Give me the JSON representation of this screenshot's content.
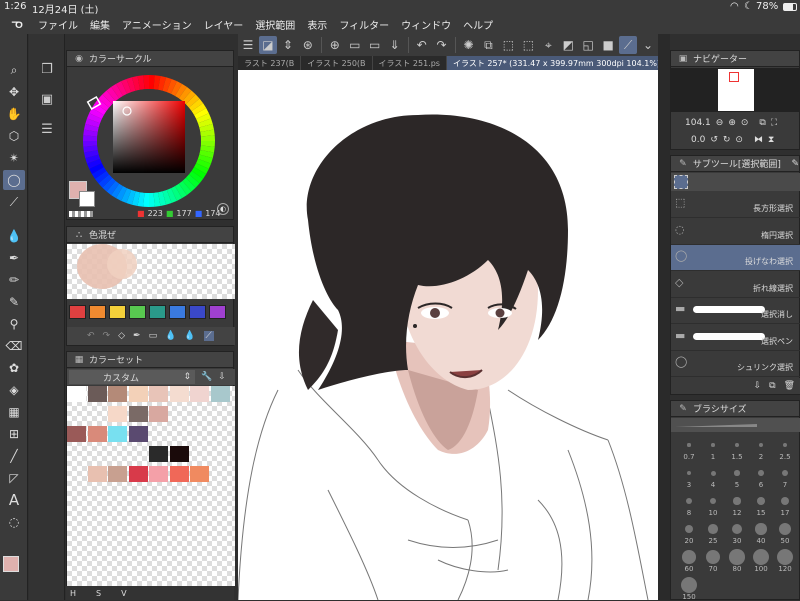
{
  "status": {
    "time": "1:26",
    "date": "12月24日 (土)",
    "battery": "78%"
  },
  "menu": [
    "ファイル",
    "編集",
    "アニメーション",
    "レイヤー",
    "選択範囲",
    "表示",
    "フィルター",
    "ウィンドウ",
    "ヘルプ"
  ],
  "panels": {
    "color_circle": {
      "title": "カラーサークル",
      "r": "223",
      "g": "177",
      "b": "174"
    },
    "color_mix": {
      "title": "色混ぜ"
    },
    "color_set": {
      "title": "カラーセット",
      "dropdown": "カスタム"
    },
    "navigator": {
      "title": "ナビゲーター",
      "zoom": "104.1",
      "angle": "0.0"
    },
    "subtool": {
      "title": "サブツール[選択範囲]",
      "items": [
        "長方形選択",
        "楕円選択",
        "投げなわ選択",
        "折れ線選択",
        "選択消し",
        "選択ペン",
        "シュリンク選択"
      ]
    },
    "brush_size": {
      "title": "ブラシサイズ",
      "sizes": [
        "0.7",
        "1",
        "1.5",
        "2",
        "2.5",
        "3",
        "4",
        "5",
        "6",
        "7",
        "8",
        "10",
        "12",
        "15",
        "17",
        "20",
        "25",
        "30",
        "40",
        "50",
        "60",
        "70",
        "80",
        "100",
        "120",
        "150"
      ]
    }
  },
  "tabs": [
    "ラスト 237(B",
    "イラスト 250(B",
    "イラスト 251.ps",
    "イラスト 257* (331.47 x 399.97mm 300dpi 104.1%)"
  ],
  "bottom_left": {
    "items": [
      "H",
      "S",
      "V"
    ]
  },
  "colors": {
    "palette_row": [
      "#e04040",
      "#f08a30",
      "#f4d03a",
      "#58c850",
      "#2a9a8a",
      "#3a7ae0",
      "#3a48c8",
      "#a040d0"
    ],
    "colorset": [
      [
        "#ffffff",
        "#6b5b58",
        "#b48a78",
        "#f3d1b8",
        "#e8c4b8",
        "#f4dcd0",
        "#f0d4d0",
        "#a8c8cc"
      ],
      [
        "",
        "",
        "#f6d8c8",
        "#7a6a66",
        "#d8a8a0",
        "",
        "",
        ""
      ],
      [
        "#9a5a58",
        "#d98a7a",
        "#78e0f0",
        "#5a4a70",
        "",
        "",
        "",
        ""
      ],
      [
        "",
        "",
        "",
        "",
        "#2a2a2a",
        "#1a0a0a",
        "",
        ""
      ],
      [
        "",
        "#e8c0b0",
        "#c8a090",
        "#d83a4a",
        "#f4a0a8",
        "#f06858",
        "#f08a60",
        ""
      ]
    ]
  }
}
